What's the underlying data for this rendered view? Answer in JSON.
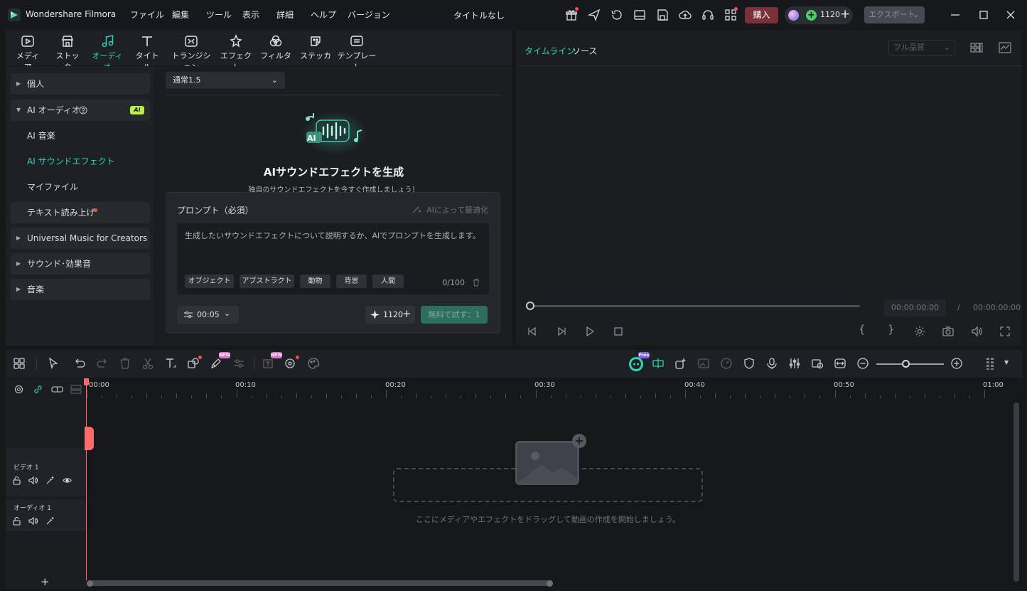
{
  "titlebar": {
    "app_name": "Wondershare Filmora",
    "menus": [
      "ファイル",
      "編集",
      "ツール",
      "表示",
      "詳細",
      "ヘルプ",
      "バージョン"
    ],
    "doc_title": "タイトルなし",
    "buy_label": "購入",
    "credits": "1120",
    "export_label": "エクスポート"
  },
  "library": {
    "tabs": [
      {
        "label": "メディア",
        "icon": "media-icon"
      },
      {
        "label": "ストック",
        "icon": "stock-icon"
      },
      {
        "label": "オーディオ",
        "icon": "music-note-icon"
      },
      {
        "label": "タイトル",
        "icon": "title-icon"
      },
      {
        "label": "トランジション",
        "icon": "transition-icon"
      },
      {
        "label": "エフェクト",
        "icon": "effect-icon"
      },
      {
        "label": "フィルター",
        "icon": "filter-icon"
      },
      {
        "label": "ステッカー",
        "icon": "sticker-icon"
      },
      {
        "label": "テンプレート",
        "icon": "template-icon"
      }
    ],
    "active_tab": "オーディオ",
    "sidebar": {
      "items": [
        {
          "label": "個人"
        },
        {
          "label": "AI オーディオ",
          "badge": "AI"
        },
        {
          "label": "AI 音楽"
        },
        {
          "label": "AI サウンドエフェクト"
        },
        {
          "label": "マイファイル"
        },
        {
          "label": "テキスト読み上げ"
        },
        {
          "label": "Universal Music for Creators"
        },
        {
          "label": "サウンド･効果音"
        },
        {
          "label": "音楽"
        }
      ]
    },
    "generator": {
      "model": "通常1.5",
      "title": "AIサウンドエフェクトを生成",
      "subtitle": "独自のサウンドエフェクトを今すぐ作成しましょう！",
      "hero_badge": "AI",
      "prompt_label": "プロンプト（必須）",
      "optimize_label": "AIによって最適化",
      "placeholder": "生成したいサウンドエフェクトについて説明するか、AIでプロンプトを生成します。",
      "chips": [
        "オブジェクト",
        "アブストラクト",
        "動物",
        "背景",
        "人間"
      ],
      "char_count": "0/100",
      "duration": "00:05",
      "cost": "1120",
      "try_label": "無料で試す：1"
    }
  },
  "player": {
    "tabs": [
      "タイムライン",
      "ソース"
    ],
    "quality": "フル品質",
    "current_time": "00:00:00:00",
    "separator": "/",
    "total_time": "00:00:00:00"
  },
  "timeline": {
    "ruler_labels": [
      "00:00",
      "00:10",
      "00:20",
      "00:30",
      "00:40",
      "00:50",
      "01:00"
    ],
    "badges": {
      "ai_mate": "Free",
      "new1": "NEW",
      "new2": "NEW"
    },
    "tracks": [
      {
        "name": "ビデオ 1"
      },
      {
        "name": "オーディオ 1"
      }
    ],
    "empty_message": "ここにメディアやエフェクトをドラッグして動画の作成を開始しましょう。",
    "add_track": "+"
  },
  "colors": {
    "accent": "#2fd4b4",
    "playhead": "#ff6b6b",
    "buy": "#7a3238",
    "ai_badge": "#b8f342"
  }
}
